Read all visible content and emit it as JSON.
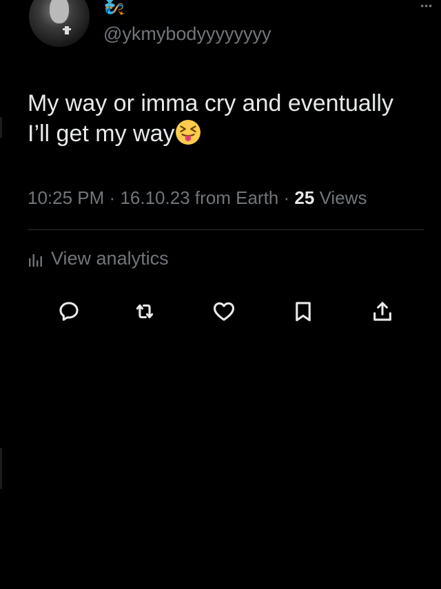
{
  "tweet": {
    "handle": "@ykmybodyyyyyyyy",
    "text_line1": "My way or imma cry and eventually",
    "text_line2": "I’ll get my way",
    "time": "10:25 PM",
    "date": "16.10.23",
    "source": "from Earth",
    "separator": "·",
    "views_count": "25",
    "views_label": "Views"
  },
  "analytics": {
    "label": "View analytics"
  },
  "actions": [
    {
      "name": "reply",
      "icon": "reply-icon"
    },
    {
      "name": "retweet",
      "icon": "retweet-icon"
    },
    {
      "name": "like",
      "icon": "heart-icon"
    },
    {
      "name": "bookmark",
      "icon": "bookmark-icon"
    },
    {
      "name": "share",
      "icon": "share-icon"
    }
  ],
  "colors": {
    "background": "#000000",
    "text": "#e7e9ea",
    "muted": "#71767b",
    "divider": "#2f3336",
    "emoji_face": "#ffcc4d",
    "emoji_tongue": "#e0457b"
  }
}
